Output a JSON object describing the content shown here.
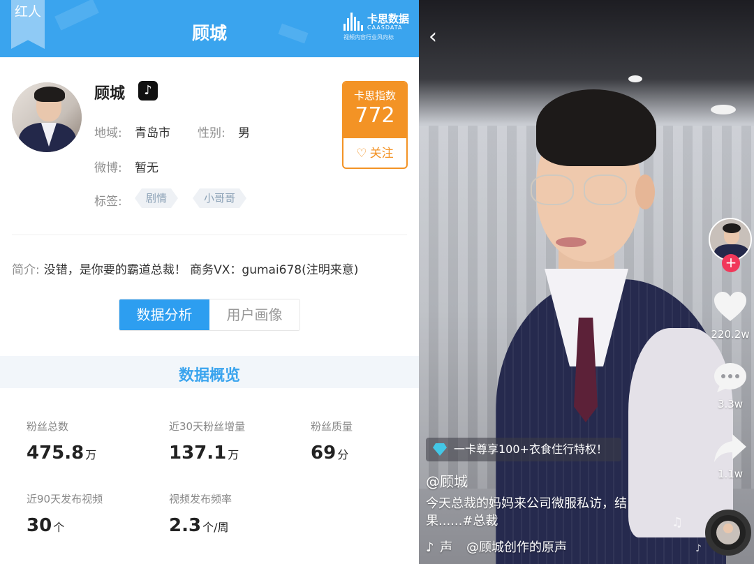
{
  "left": {
    "header": {
      "ribbon_text": "红人",
      "title": "顾城",
      "brand_name": "卡思数据",
      "brand_en": "CAASDATA",
      "brand_sub": "视频内容行业风向标"
    },
    "profile": {
      "name": "顾城",
      "platform_icon": "tiktok-icon",
      "region_label": "地域:",
      "region_value": "青岛市",
      "gender_label": "性别:",
      "gender_value": "男",
      "weibo_label": "微博:",
      "weibo_value": "暂无",
      "tags_label": "标签:",
      "tags": [
        "剧情",
        "小哥哥"
      ]
    },
    "score": {
      "title": "卡思指数",
      "value": "772",
      "follow_label": "关注"
    },
    "intro": {
      "label": "简介:",
      "text": "没错，是你要的霸道总裁！ 商务VX：gumai678(注明来意)"
    },
    "tabs": [
      {
        "label": "数据分析",
        "active": true
      },
      {
        "label": "用户画像",
        "active": false
      }
    ],
    "overview": {
      "title": "数据概览",
      "stats": [
        {
          "label": "粉丝总数",
          "value": "475.8",
          "unit": "万"
        },
        {
          "label": "近30天粉丝增量",
          "value": "137.1",
          "unit": "万"
        },
        {
          "label": "粉丝质量",
          "value": "69",
          "unit": "分"
        },
        {
          "label": "近90天发布视频",
          "value": "30",
          "unit": "个"
        },
        {
          "label": "视频发布频率",
          "value": "2.3",
          "unit": "个/周"
        }
      ]
    }
  },
  "right": {
    "like_count": "220.2w",
    "comment_count": "3.3w",
    "share_count": "1.1w",
    "promo_text": "一卡尊享100+衣食住行特权！",
    "username": "@顾城",
    "description": "今天总裁的妈妈来公司微服私访，结果......#总裁",
    "music_prefix": "声",
    "music_text": "@顾城创作的原声",
    "music_tail": "ҫ",
    "colors": {
      "header_blue": "#3aa4ee",
      "score_orange": "#f39325",
      "tab_active": "#2d9ef0",
      "follow_plus": "#f1385a"
    }
  }
}
